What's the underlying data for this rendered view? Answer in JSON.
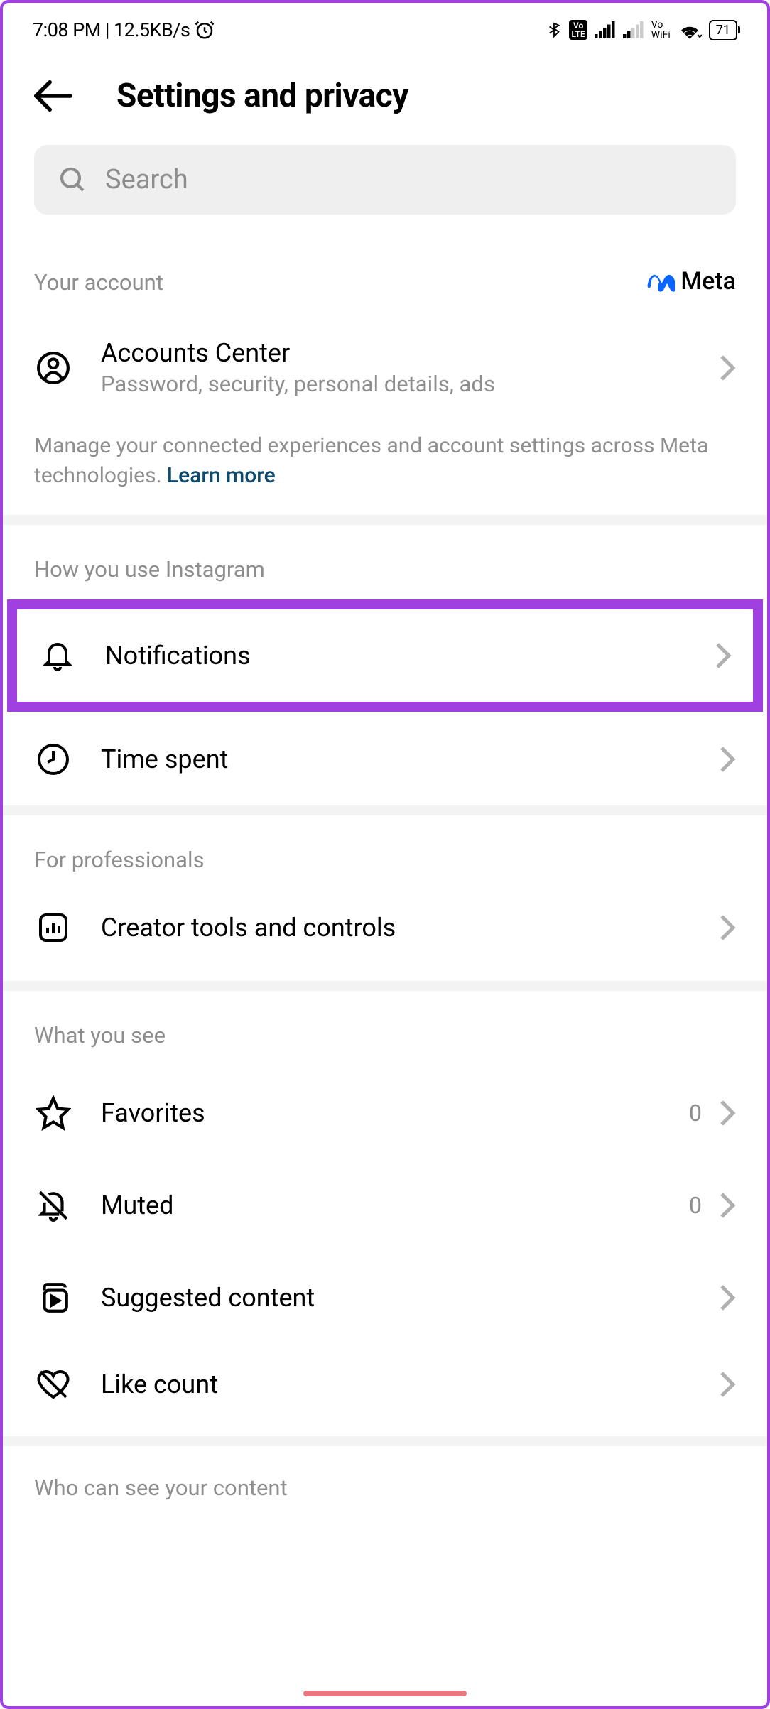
{
  "status": {
    "time": "7:08 PM",
    "sep": " | ",
    "data_rate": "12.5KB/s",
    "volte": "Vo\nLTE",
    "vowifi_top": "Vo",
    "vowifi_bot": "WiFi",
    "battery": "71"
  },
  "header": {
    "title": "Settings and privacy"
  },
  "search": {
    "placeholder": "Search"
  },
  "your_account": {
    "section": "Your account",
    "meta": "Meta",
    "accounts_center": "Accounts Center",
    "accounts_sub": "Password, security, personal details, ads",
    "description": "Manage your connected experiences and account settings across Meta technologies. ",
    "learn_more": "Learn more"
  },
  "how_you_use": {
    "section": "How you use Instagram",
    "notifications": "Notifications",
    "time_spent": "Time spent"
  },
  "professionals": {
    "section": "For professionals",
    "creator": "Creator tools and controls"
  },
  "what_you_see": {
    "section": "What you see",
    "favorites": "Favorites",
    "favorites_count": "0",
    "muted": "Muted",
    "muted_count": "0",
    "suggested": "Suggested content",
    "like_count": "Like count"
  },
  "visibility": {
    "section": "Who can see your content"
  }
}
